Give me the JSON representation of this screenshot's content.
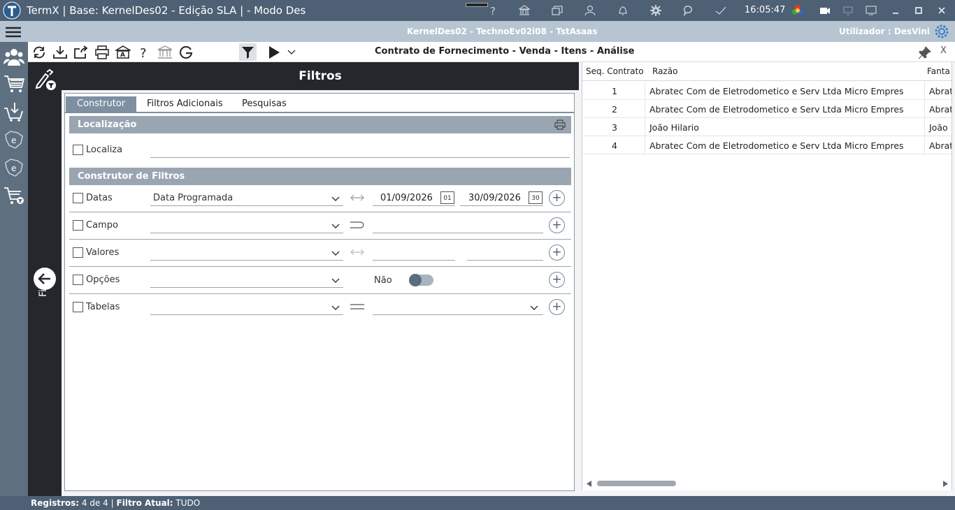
{
  "titlebar": {
    "title": "TermX | Base: KernelDes02 - Edição SLA | - Modo Des",
    "clock": "16:05:47",
    "icons": [
      "help-icon",
      "bank-icon",
      "windows-icon",
      "user-icon",
      "bell-icon",
      "gear-icon",
      "chat-icon",
      "check-icon",
      "palette-icon",
      "camera-icon",
      "monitor-icon",
      "monitor2-icon",
      "minimize-icon",
      "maximize-icon",
      "close-icon"
    ]
  },
  "bar2": {
    "center": "KernelDes02 - TechnoEv02i08 - TstAsaas",
    "user_label": "Utilizador :",
    "user_name": "DesVini"
  },
  "toolbar": {
    "window_title": "Contrato de Fornecimento - Venda - Itens - Análise",
    "close": "X"
  },
  "filters": {
    "header": "Filtros",
    "side_label": "Filtros",
    "tabs": [
      "Construtor",
      "Filtros Adicionais",
      "Pesquisas"
    ],
    "section_localizacao": "Localização",
    "localiza_label": "Localiza",
    "section_construtor": "Construtor de Filtros",
    "rows": {
      "datas": {
        "label": "Datas",
        "field": "Data Programada",
        "date_from": "01/09/2026",
        "date_to": "30/09/2026",
        "cal_from": "01",
        "cal_to": "30"
      },
      "campo": {
        "label": "Campo"
      },
      "valores": {
        "label": "Valores"
      },
      "opcoes": {
        "label": "Opções",
        "toggle_text": "Não"
      },
      "tabelas": {
        "label": "Tabelas"
      }
    }
  },
  "grid": {
    "columns": [
      "Seq. Contrato",
      "Razão",
      "Fanta"
    ],
    "rows": [
      {
        "seq": "1",
        "razao": "Abratec Com de Eletrodometico e Serv Ltda Micro Empres",
        "fanta": "Abrat"
      },
      {
        "seq": "2",
        "razao": "Abratec Com de Eletrodometico e Serv Ltda Micro Empres",
        "fanta": "Abrat"
      },
      {
        "seq": "3",
        "razao": "João Hilario",
        "fanta": "João"
      },
      {
        "seq": "4",
        "razao": "Abratec Com de Eletrodometico e Serv Ltda Micro Empres",
        "fanta": "Abrat"
      }
    ]
  },
  "status": {
    "registros_label": "Registros:",
    "registros_value": "4 de 4",
    "sep": "|",
    "filtro_label": "Filtro Atual:",
    "filtro_value": "TUDO"
  }
}
